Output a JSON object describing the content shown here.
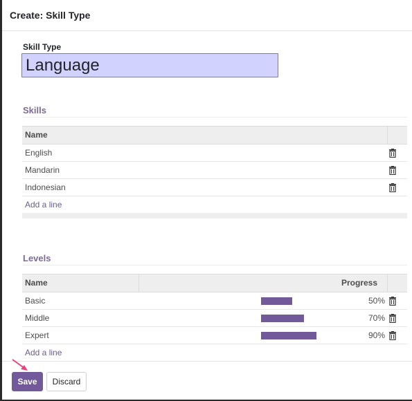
{
  "dialog": {
    "title": "Create: Skill Type"
  },
  "form": {
    "name_label": "Skill Type",
    "name_value": "Language"
  },
  "skills": {
    "section_title": "Skills",
    "column_name": "Name",
    "rows": [
      {
        "name": "English"
      },
      {
        "name": "Mandarin"
      },
      {
        "name": "Indonesian"
      }
    ],
    "add_line": "Add a line"
  },
  "levels": {
    "section_title": "Levels",
    "column_name": "Name",
    "column_progress": "Progress",
    "rows": [
      {
        "name": "Basic",
        "progress": 50,
        "progress_label": "50%"
      },
      {
        "name": "Middle",
        "progress": 70,
        "progress_label": "70%"
      },
      {
        "name": "Expert",
        "progress": 90,
        "progress_label": "90%"
      }
    ],
    "add_line": "Add a line"
  },
  "footer": {
    "save_label": "Save",
    "discard_label": "Discard"
  },
  "colors": {
    "accent": "#725a9a",
    "input_bg": "#d2d2ff",
    "arrow": "#e8437a"
  },
  "icons": {
    "delete": "trash-icon",
    "pointer": "arrow-icon"
  }
}
